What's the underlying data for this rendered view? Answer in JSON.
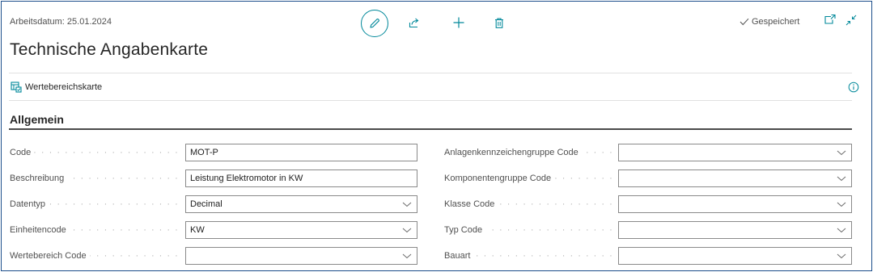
{
  "header": {
    "work_date": "Arbeitsdatum: 25.01.2024",
    "title": "Technische Angabenkarte",
    "saved_status": "Gespeichert"
  },
  "actions": {
    "range_card": "Wertebereichskarte"
  },
  "section": {
    "title": "Allgemein"
  },
  "left_fields": [
    {
      "label": "Code",
      "value": "MOT-P",
      "type": "text"
    },
    {
      "label": "Beschreibung",
      "value": "Leistung Elektromotor in KW",
      "type": "text"
    },
    {
      "label": "Datentyp",
      "value": "Decimal",
      "type": "select"
    },
    {
      "label": "Einheitencode",
      "value": "KW",
      "type": "select"
    },
    {
      "label": "Wertebereich Code",
      "value": "",
      "type": "select"
    }
  ],
  "right_fields": [
    {
      "label": "Anlagenkennzeichengruppe Code",
      "value": "",
      "type": "select"
    },
    {
      "label": "Komponentengruppe Code",
      "value": "",
      "type": "select"
    },
    {
      "label": "Klasse Code",
      "value": "",
      "type": "select"
    },
    {
      "label": "Typ Code",
      "value": "",
      "type": "select"
    },
    {
      "label": "Bauart",
      "value": "",
      "type": "select"
    }
  ],
  "colors": {
    "accent": "#00889a",
    "frame_border": "#1e4f8c",
    "input_border": "#8a8a8a"
  },
  "icons": [
    "edit-icon",
    "share-icon",
    "add-icon",
    "delete-icon",
    "checkmark-icon",
    "popout-icon",
    "collapse-icon",
    "range-card-icon",
    "info-icon",
    "chevron-down-icon"
  ]
}
